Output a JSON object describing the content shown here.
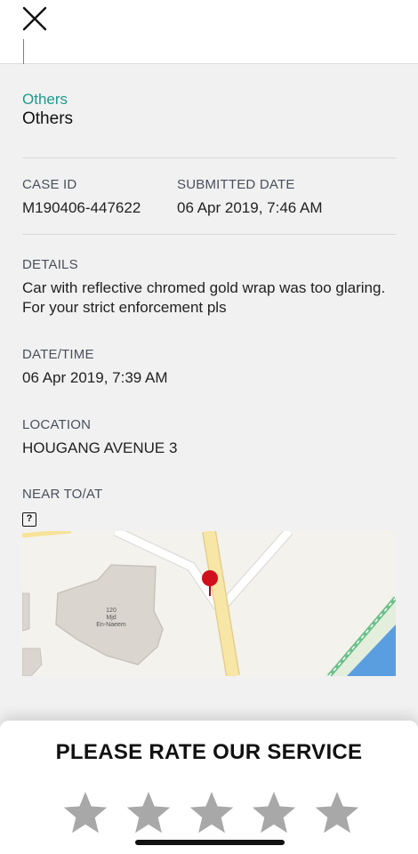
{
  "header": {
    "close_icon": "close-icon"
  },
  "category": {
    "label": "Others",
    "value": "Others"
  },
  "case": {
    "case_id_label": "CASE ID",
    "case_id_value": "M190406-447622",
    "submitted_label": "SUBMITTED DATE",
    "submitted_value": "06 Apr 2019, 7:46 AM"
  },
  "details": {
    "label": "DETAILS",
    "value": "Car with reflective chromed gold wrap was too glaring. For your strict enforcement pls"
  },
  "datetime": {
    "label": "DATE/TIME",
    "value": "06 Apr 2019, 7:39 AM"
  },
  "location": {
    "label": "LOCATION",
    "value": "HOUGANG AVENUE 3"
  },
  "near": {
    "label": "NEAR TO/AT",
    "icon": "unknown-image-icon",
    "icon_glyph": "?"
  },
  "map": {
    "building_number": "120",
    "building_name_line1": "Mjd",
    "building_name_line2": "En-Naeem",
    "pin_icon": "map-pin-icon"
  },
  "rating": {
    "title": "PLEASE RATE OUR SERVICE",
    "max_stars": 5,
    "selected": 0
  },
  "colors": {
    "accent": "#1f9a8c",
    "background": "#f1f1f1",
    "star_inactive": "#a8a8a8",
    "pin": "#d0101c"
  }
}
